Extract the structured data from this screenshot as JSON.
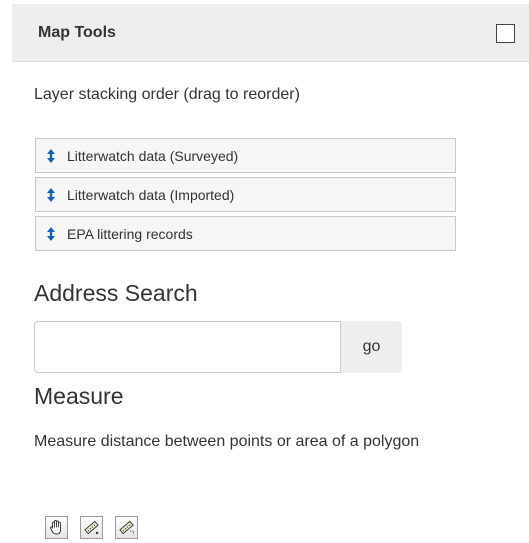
{
  "panel": {
    "title": "Map Tools"
  },
  "layers": {
    "intro": "Layer stacking order (drag to reorder)",
    "items": [
      {
        "label": "Litterwatch data (Surveyed)"
      },
      {
        "label": "Litterwatch data (Imported)"
      },
      {
        "label": "EPA littering records"
      }
    ],
    "drag_icon": "vertical-double-arrow-icon",
    "drag_icon_color": "#1a5fb4"
  },
  "address_search": {
    "title": "Address Search",
    "input_value": "",
    "input_placeholder": "",
    "go_label": "go"
  },
  "measure": {
    "title": "Measure",
    "description": "Measure distance between points or area of a polygon",
    "tools": [
      "pan-hand-icon",
      "measure-distance-icon",
      "measure-area-icon"
    ]
  }
}
